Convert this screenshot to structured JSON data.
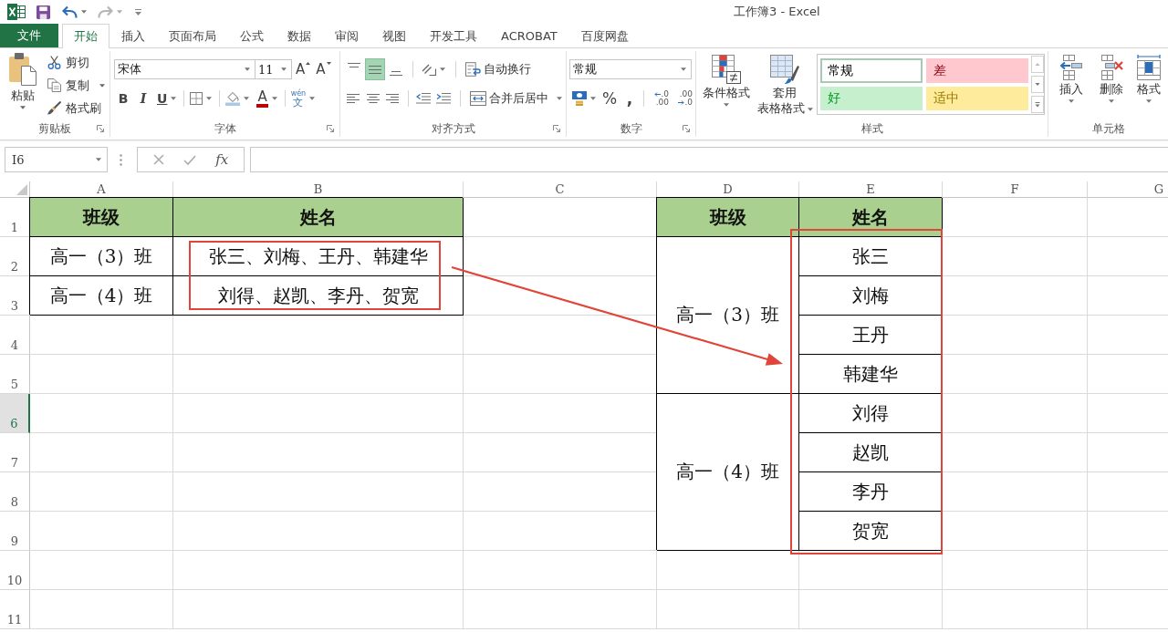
{
  "title_bar": {
    "title": "工作簿3 - Excel"
  },
  "tabs": [
    {
      "label": "文件",
      "kind": "file",
      "selected": false
    },
    {
      "label": "开始",
      "kind": "tab",
      "selected": true
    },
    {
      "label": "插入",
      "kind": "tab",
      "selected": false
    },
    {
      "label": "页面布局",
      "kind": "tab",
      "selected": false
    },
    {
      "label": "公式",
      "kind": "tab",
      "selected": false
    },
    {
      "label": "数据",
      "kind": "tab",
      "selected": false
    },
    {
      "label": "审阅",
      "kind": "tab",
      "selected": false
    },
    {
      "label": "视图",
      "kind": "tab",
      "selected": false
    },
    {
      "label": "开发工具",
      "kind": "tab",
      "selected": false
    },
    {
      "label": "ACROBAT",
      "kind": "tab",
      "selected": false
    },
    {
      "label": "百度网盘",
      "kind": "tab",
      "selected": false
    }
  ],
  "ribbon": {
    "clipboard": {
      "title": "剪贴板",
      "paste": "粘贴",
      "cut": "剪切",
      "copy": "复制",
      "format_painter": "格式刷"
    },
    "font": {
      "title": "字体",
      "font_name": "宋体",
      "font_size": "11",
      "grow": "A",
      "shrink": "A",
      "bold": "B",
      "italic": "I",
      "underline": "U",
      "font_color": "A",
      "phonetic_top": "wén",
      "phonetic": "文"
    },
    "alignment": {
      "title": "对齐方式",
      "vertical": [
        {
          "kind": "top",
          "selected": false
        },
        {
          "kind": "middle",
          "selected": true
        },
        {
          "kind": "bottom",
          "selected": false
        }
      ],
      "horizontal": [
        {
          "kind": "left",
          "selected": false
        },
        {
          "kind": "center",
          "selected": false
        },
        {
          "kind": "right",
          "selected": false
        }
      ],
      "wrap_text": "自动换行",
      "merge_center": "合并后居中"
    },
    "number": {
      "title": "数字",
      "format": "常规",
      "percent": "%",
      "comma": ",",
      "increase_decimal": [
        ".0",
        ".00"
      ],
      "decrease_decimal": [
        ".00",
        ".0"
      ]
    },
    "styles": {
      "title": "样式",
      "conditional_formatting": "条件格式",
      "format_as_table": [
        "套用",
        "表格格式"
      ],
      "cell_styles": [
        {
          "label": "常规",
          "color": "#ffffff",
          "selected": true
        },
        {
          "label": "差",
          "color": "#ffc7ce",
          "selected": false
        },
        {
          "label": "好",
          "color": "#c6efce",
          "selected": false
        },
        {
          "label": "适中",
          "color": "#ffeb9c",
          "selected": false
        }
      ]
    },
    "cells": {
      "title": "单元格",
      "insert": "插入",
      "delete": "删除",
      "format": "格式"
    }
  },
  "formula_bar": {
    "name_box": "I6",
    "fx": "fx"
  },
  "sheet": {
    "columns": [
      {
        "label": "A",
        "selected": false
      },
      {
        "label": "B",
        "selected": false
      },
      {
        "label": "C",
        "selected": false
      },
      {
        "label": "D",
        "selected": false
      },
      {
        "label": "E",
        "selected": false
      },
      {
        "label": "F",
        "selected": false
      },
      {
        "label": "G",
        "selected": false
      }
    ],
    "rows": [
      {
        "label": "1",
        "selected": false
      },
      {
        "label": "2",
        "selected": false
      },
      {
        "label": "3",
        "selected": false
      },
      {
        "label": "4",
        "selected": false
      },
      {
        "label": "5",
        "selected": false
      },
      {
        "label": "6",
        "selected": true
      },
      {
        "label": "7",
        "selected": false
      },
      {
        "label": "8",
        "selected": false
      },
      {
        "label": "9",
        "selected": false
      },
      {
        "label": "10",
        "selected": false
      },
      {
        "label": "11",
        "selected": false
      }
    ],
    "table_1": {
      "headers": [
        "班级",
        "姓名"
      ],
      "rows": [
        [
          "高一（3）班",
          "张三、刘梅、王丹、韩建华"
        ],
        [
          "高一（4）班",
          "刘得、赵凯、李丹、贺宽"
        ]
      ]
    },
    "table_2": {
      "headers": [
        "班级",
        "姓名"
      ],
      "groups": [
        {
          "class": "高一（3）班",
          "names": [
            "张三",
            "刘梅",
            "王丹",
            "韩建华"
          ]
        },
        {
          "class": "高一（4）班",
          "names": [
            "刘得",
            "赵凯",
            "李丹",
            "贺宽"
          ]
        }
      ]
    }
  }
}
